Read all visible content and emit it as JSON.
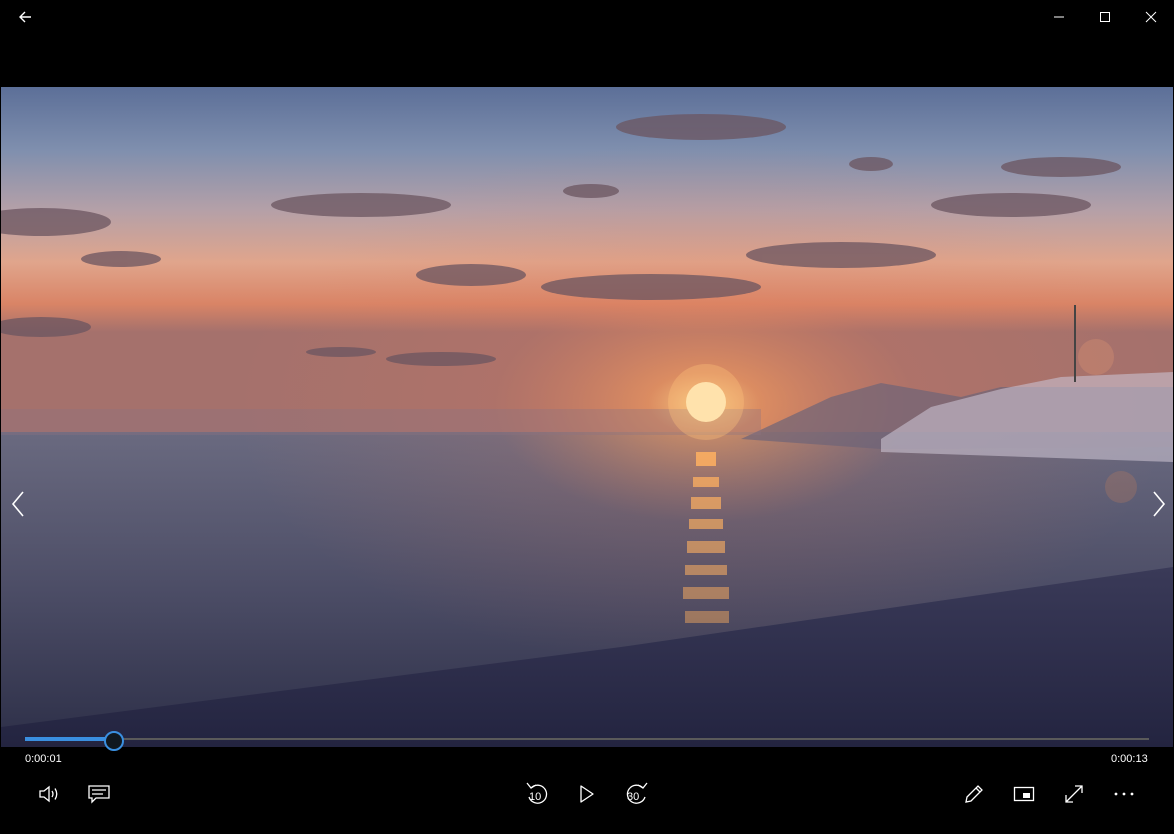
{
  "playback": {
    "current_time": "0:00:01",
    "total_time": "0:00:13",
    "progress": 0.078
  },
  "controls": {
    "skip_back_seconds": "10",
    "skip_forward_seconds": "30"
  },
  "icons": {
    "back": "back-arrow-icon",
    "minimize": "minimize-icon",
    "maximize": "maximize-icon",
    "close": "close-icon",
    "previous": "chevron-left-icon",
    "next": "chevron-right-icon",
    "volume": "speaker-icon",
    "captions": "captions-icon",
    "play": "play-icon",
    "edit": "pencil-icon",
    "mini_view": "mini-view-icon",
    "full_screen": "fullscreen-icon",
    "more": "more-icon"
  },
  "colors": {
    "accent": "#3a8fe0",
    "background": "#000000"
  }
}
